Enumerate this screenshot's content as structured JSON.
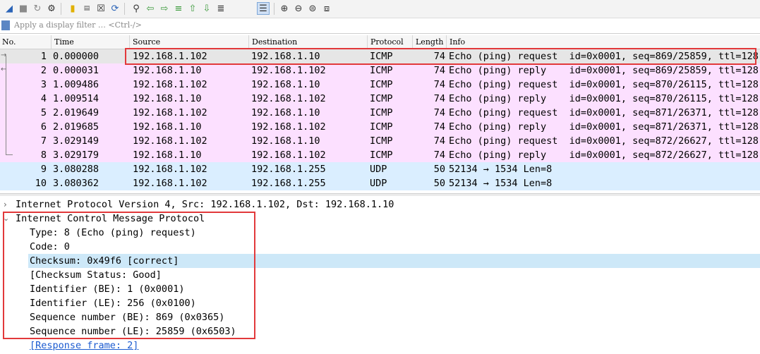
{
  "filter": {
    "placeholder": "Apply a display filter … <Ctrl-/>"
  },
  "columns": [
    "No.",
    "Time",
    "Source",
    "Destination",
    "Protocol",
    "Length",
    "Info"
  ],
  "packets": [
    {
      "no": "1",
      "time": "0.000000",
      "src": "192.168.1.102",
      "dst": "192.168.1.10",
      "proto": "ICMP",
      "len": "74",
      "info": "Echo (ping) request  id=0x0001, seq=869/25859, ttl=128"
    },
    {
      "no": "2",
      "time": "0.000031",
      "src": "192.168.1.10",
      "dst": "192.168.1.102",
      "proto": "ICMP",
      "len": "74",
      "info": "Echo (ping) reply    id=0x0001, seq=869/25859, ttl=128"
    },
    {
      "no": "3",
      "time": "1.009486",
      "src": "192.168.1.102",
      "dst": "192.168.1.10",
      "proto": "ICMP",
      "len": "74",
      "info": "Echo (ping) request  id=0x0001, seq=870/26115, ttl=128"
    },
    {
      "no": "4",
      "time": "1.009514",
      "src": "192.168.1.10",
      "dst": "192.168.1.102",
      "proto": "ICMP",
      "len": "74",
      "info": "Echo (ping) reply    id=0x0001, seq=870/26115, ttl=128"
    },
    {
      "no": "5",
      "time": "2.019649",
      "src": "192.168.1.102",
      "dst": "192.168.1.10",
      "proto": "ICMP",
      "len": "74",
      "info": "Echo (ping) request  id=0x0001, seq=871/26371, ttl=128"
    },
    {
      "no": "6",
      "time": "2.019685",
      "src": "192.168.1.10",
      "dst": "192.168.1.102",
      "proto": "ICMP",
      "len": "74",
      "info": "Echo (ping) reply    id=0x0001, seq=871/26371, ttl=128"
    },
    {
      "no": "7",
      "time": "3.029149",
      "src": "192.168.1.102",
      "dst": "192.168.1.10",
      "proto": "ICMP",
      "len": "74",
      "info": "Echo (ping) request  id=0x0001, seq=872/26627, ttl=128"
    },
    {
      "no": "8",
      "time": "3.029179",
      "src": "192.168.1.10",
      "dst": "192.168.1.102",
      "proto": "ICMP",
      "len": "74",
      "info": "Echo (ping) reply    id=0x0001, seq=872/26627, ttl=128"
    },
    {
      "no": "9",
      "time": "3.080288",
      "src": "192.168.1.102",
      "dst": "192.168.1.255",
      "proto": "UDP",
      "len": "50",
      "info": "52134 → 1534 Len=8"
    },
    {
      "no": "10",
      "time": "3.080362",
      "src": "192.168.1.102",
      "dst": "192.168.1.255",
      "proto": "UDP",
      "len": "50",
      "info": "52134 → 1534 Len=8"
    }
  ],
  "details": {
    "ip_line": "Internet Protocol Version 4, Src: 192.168.1.102, Dst: 192.168.1.10",
    "icmp_line": "Internet Control Message Protocol",
    "fields": [
      "Type: 8 (Echo (ping) request)",
      "Code: 0",
      "Checksum: 0x49f6 [correct]",
      "[Checksum Status: Good]",
      "Identifier (BE): 1 (0x0001)",
      "Identifier (LE): 256 (0x0100)",
      "Sequence number (BE): 869 (0x0365)",
      "Sequence number (LE): 25859 (0x6503)"
    ],
    "response_link": "[Response frame: 2]"
  },
  "colors": {
    "icmp_row": "#fce0ff",
    "udp_row": "#daeeff",
    "annotation": "#e2393b"
  }
}
